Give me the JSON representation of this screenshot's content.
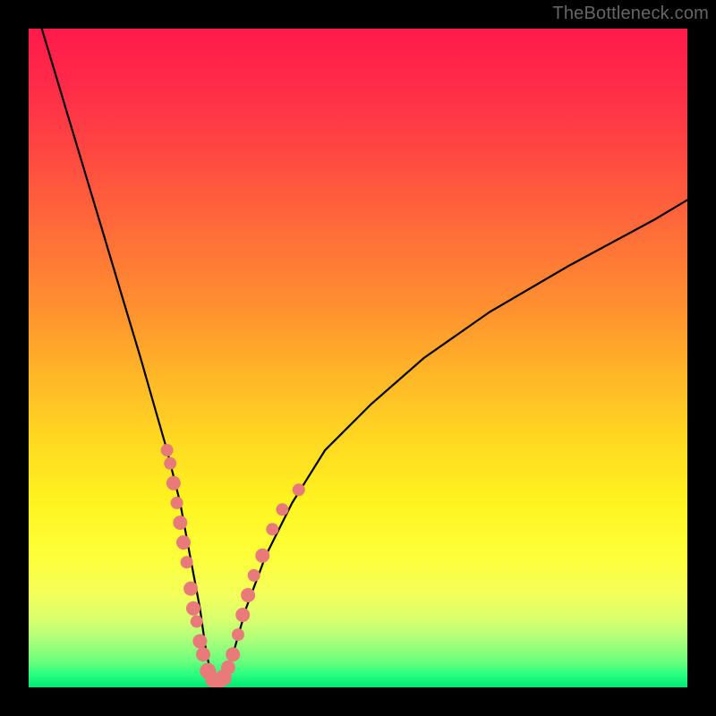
{
  "watermark": "TheBottleneck.com",
  "chart_data": {
    "type": "line",
    "title": "",
    "xlabel": "",
    "ylabel": "",
    "xlim": [
      0,
      100
    ],
    "ylim": [
      0,
      100
    ],
    "series": [
      {
        "name": "bottleneck-curve",
        "x": [
          2,
          5,
          8,
          11,
          14,
          17,
          19,
          21,
          23,
          24.5,
          26,
          27,
          28,
          29.5,
          31,
          33,
          36,
          40,
          45,
          52,
          60,
          70,
          82,
          95,
          100
        ],
        "y": [
          100,
          90,
          80,
          70,
          60,
          50,
          43,
          36,
          28,
          20,
          12,
          5,
          1,
          1,
          5,
          12,
          20,
          28,
          36,
          43,
          50,
          57,
          64,
          71,
          74
        ]
      }
    ],
    "markers": {
      "name": "highlight-points",
      "color": "#e97a7a",
      "points": [
        {
          "x": 21.0,
          "y": 36,
          "r": 7
        },
        {
          "x": 21.5,
          "y": 34,
          "r": 7
        },
        {
          "x": 22.0,
          "y": 31,
          "r": 8
        },
        {
          "x": 22.5,
          "y": 28,
          "r": 7
        },
        {
          "x": 23.0,
          "y": 25,
          "r": 8
        },
        {
          "x": 23.5,
          "y": 22,
          "r": 8
        },
        {
          "x": 24.0,
          "y": 19,
          "r": 7
        },
        {
          "x": 24.6,
          "y": 15,
          "r": 8
        },
        {
          "x": 25.0,
          "y": 12,
          "r": 8
        },
        {
          "x": 25.5,
          "y": 10,
          "r": 7
        },
        {
          "x": 26.0,
          "y": 7,
          "r": 8
        },
        {
          "x": 26.5,
          "y": 5,
          "r": 8
        },
        {
          "x": 27.2,
          "y": 2.5,
          "r": 9
        },
        {
          "x": 28.0,
          "y": 1.2,
          "r": 9
        },
        {
          "x": 28.8,
          "y": 1.0,
          "r": 9
        },
        {
          "x": 29.6,
          "y": 1.5,
          "r": 9
        },
        {
          "x": 30.3,
          "y": 3,
          "r": 8
        },
        {
          "x": 31.0,
          "y": 5,
          "r": 8
        },
        {
          "x": 31.8,
          "y": 8,
          "r": 7
        },
        {
          "x": 32.5,
          "y": 11,
          "r": 8
        },
        {
          "x": 33.3,
          "y": 14,
          "r": 8
        },
        {
          "x": 34.2,
          "y": 17,
          "r": 7
        },
        {
          "x": 35.5,
          "y": 20,
          "r": 8
        },
        {
          "x": 37.0,
          "y": 24,
          "r": 7
        },
        {
          "x": 38.5,
          "y": 27,
          "r": 7
        },
        {
          "x": 41.0,
          "y": 30,
          "r": 7
        }
      ]
    }
  }
}
